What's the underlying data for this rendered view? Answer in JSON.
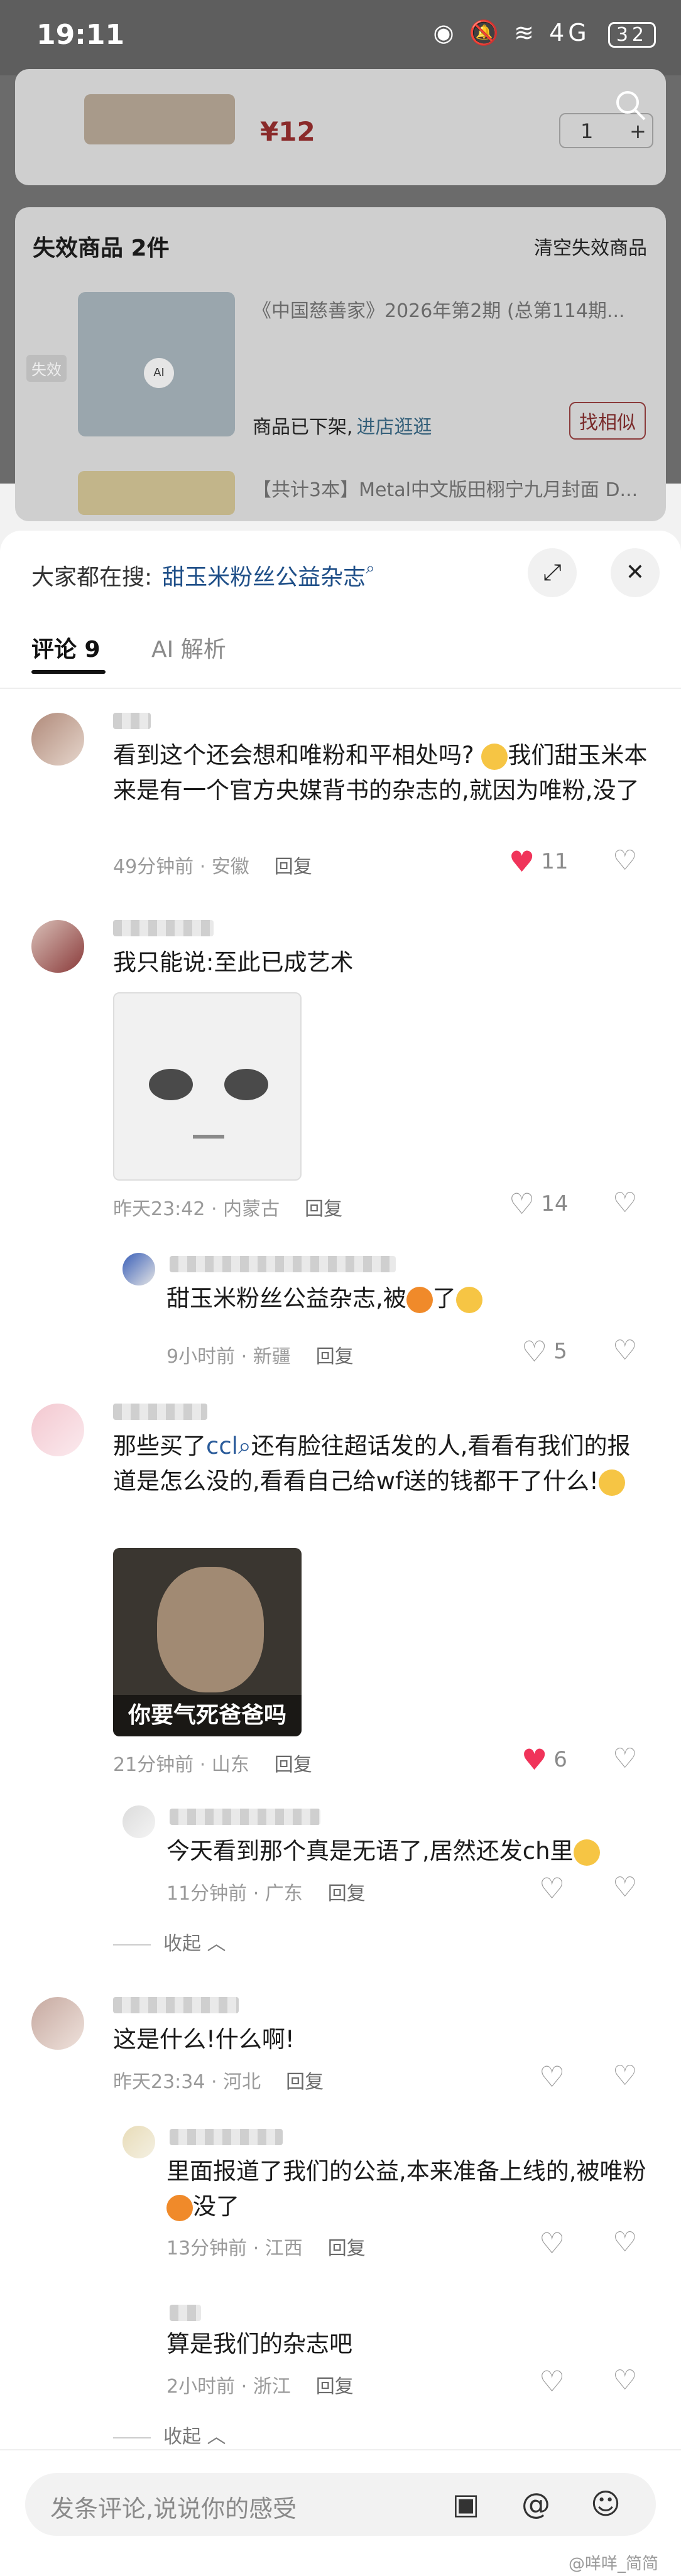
{
  "status_bar": {
    "time": "19:11",
    "signal": "4G",
    "battery": "32"
  },
  "cart_item": {
    "price": "¥12",
    "quantity": "1"
  },
  "invalid_section": {
    "title": "失效商品 2件",
    "clear_label": "清空失效商品",
    "tag": "失效",
    "item_name": "《中国慈善家》2026年第2期 (总第114期...",
    "status_text": "商品已下架,",
    "link_text": "进店逛逛",
    "find_similar": "找相似",
    "next_item_name": "【共计3本】Metal中文版田栩宁九月封面 D..."
  },
  "sheet": {
    "search_prefix": "大家都在搜:",
    "search_keyword": "甜玉米粉丝公益杂志",
    "tabs": [
      {
        "label": "评论 9"
      },
      {
        "label": "AI 解析"
      }
    ]
  },
  "comments": [
    {
      "text": "看到这个还会想和唯粉和平相处吗?",
      "text2": "我们甜玉米本来是有一个官方央媒背书的杂志的,就因为唯粉,没了",
      "time": "49分钟前 · 安徽",
      "reply": "回复",
      "likes": "11",
      "liked": true
    },
    {
      "text": "我只能说:至此已成艺术",
      "time": "昨天23:42 · 内蒙古",
      "reply": "回复",
      "likes": "14",
      "liked": false
    },
    {
      "text": "甜玉米粉丝公益杂志,被",
      "text2": "了",
      "time": "9小时前 · 新疆",
      "reply": "回复",
      "likes": "5",
      "liked": false
    },
    {
      "text_pre": "那些买了",
      "mention": "ccl",
      "text_post": "还有脸往超话发的人,看看有我们的报道是怎么没的,看看自己给wf送的钱都干了什么!",
      "image_caption": "你要气死爸爸吗",
      "time": "21分钟前 · 山东",
      "reply": "回复",
      "likes": "6",
      "liked": true
    },
    {
      "text": "今天看到那个真是无语了,居然还发ch里",
      "time": "11分钟前 · 广东",
      "reply": "回复"
    },
    {
      "text": "这是什么!什么啊!",
      "time": "昨天23:34 · 河北",
      "reply": "回复"
    },
    {
      "text": "里面报道了我们的公益,本来准备上线的,被唯粉",
      "text2": "没了",
      "time": "13分钟前 · 江西",
      "reply": "回复"
    },
    {
      "text": "算是我们的杂志吧",
      "time": "2小时前 · 浙江",
      "reply": "回复"
    }
  ],
  "collapse_label": "收起",
  "input": {
    "placeholder": "发条评论,说说你的感受"
  },
  "watermark": "@咩咩_简简"
}
